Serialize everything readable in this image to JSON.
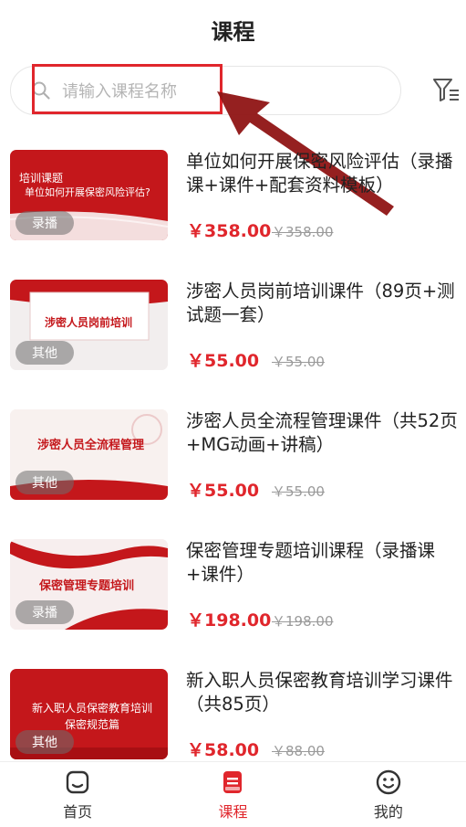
{
  "header": {
    "title": "课程"
  },
  "search": {
    "placeholder": "请输入课程名称"
  },
  "courses": [
    {
      "thumb_line1": "培训课题",
      "thumb_line2": "单位如何开展保密风险评估?",
      "badge": "录播",
      "title": "单位如何开展保密风险评估（录播课+课件+配套资料模板）",
      "price": "￥358.00",
      "original_price": "￥358.00"
    },
    {
      "thumb_line1": "涉密人员岗前培训",
      "badge": "其他",
      "title": "涉密人员岗前培训课件（89页+测试题一套）",
      "price": "￥55.00",
      "original_price": "￥55.00"
    },
    {
      "thumb_line1": "涉密人员全流程管理",
      "badge": "其他",
      "title": "涉密人员全流程管理课件（共52页+MG动画+讲稿）",
      "price": "￥55.00",
      "original_price": "￥55.00"
    },
    {
      "thumb_line1": "保密管理专题培训",
      "badge": "录播",
      "title": "保密管理专题培训课程（录播课+课件）",
      "price": "￥198.00",
      "original_price": "￥198.00"
    },
    {
      "thumb_line1": "新入职人员保密教育培训",
      "thumb_line2": "保密规范篇",
      "badge": "其他",
      "title": "新入职人员保密教育培训学习课件（共85页）",
      "price": "￥58.00",
      "original_price": "￥88.00"
    }
  ],
  "tabbar": {
    "home": "首页",
    "courses": "课程",
    "mine": "我的"
  },
  "colors": {
    "accent": "#e0262c"
  },
  "icons": {
    "search": "search-icon",
    "filter": "filter-icon",
    "home": "home-icon",
    "courses": "book-icon",
    "mine": "smiley-icon"
  }
}
